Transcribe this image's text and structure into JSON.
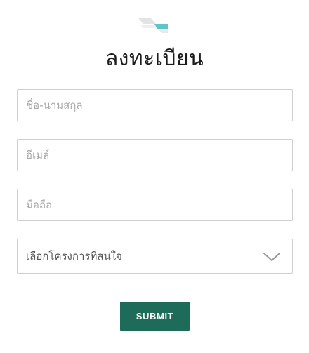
{
  "logo": {
    "icon": "brand-logo-icon",
    "colors": {
      "grey": "#e3e3e3",
      "teal": "#5fc4c9"
    }
  },
  "form": {
    "title": "ลงทะเบียน",
    "fields": {
      "name": {
        "placeholder": "ชื่อ-นามสกุล",
        "value": ""
      },
      "email": {
        "placeholder": "อีเมล์",
        "value": ""
      },
      "phone": {
        "placeholder": "มือถือ",
        "value": ""
      }
    },
    "project_select": {
      "selected": "เลือกโครงการที่สนใจ",
      "icon": "chevron-down-icon"
    },
    "submit_label": "SUBMIT"
  },
  "colors": {
    "button": "#1f6b5a",
    "border": "#cfcfcf",
    "placeholder": "#a9a9a9"
  }
}
